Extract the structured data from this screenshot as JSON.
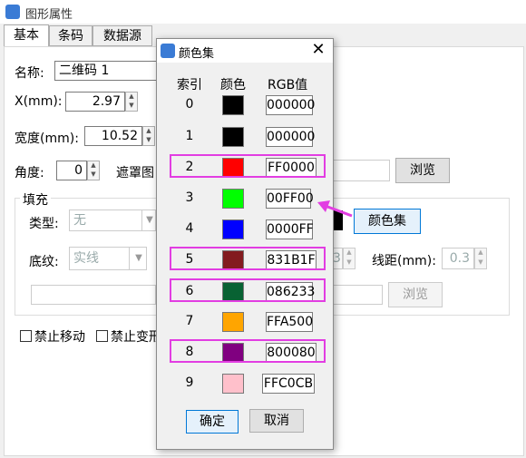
{
  "window": {
    "title": "图形属性"
  },
  "tabs": [
    "基本",
    "条码",
    "数据源"
  ],
  "form": {
    "name_label": "名称:",
    "name_value": "二维码 1",
    "x_label": "X(mm):",
    "x_value": "2.97",
    "width_label": "宽度(mm):",
    "width_value": "10.52",
    "angle_label": "角度:",
    "angle_value": "0",
    "mask_label": "遮罩图",
    "browse_label": "浏览",
    "fill_group": "填充",
    "type_label": "类型:",
    "type_value": "无",
    "pattern_label": "底纹:",
    "pattern_value": "实线",
    "color_set_label": "颜色集",
    "line_spacing_label": "线距(mm):",
    "line_spacing_value": "0.3",
    "partial_spin_value": "3",
    "browse2_label": "浏览",
    "lock_move_label": "禁止移动",
    "lock_transform_label": "禁止变形"
  },
  "dialog": {
    "title": "颜色集",
    "close_icon": "close-icon",
    "col_index": "索引",
    "col_color": "颜色",
    "col_rgb": "RGB值",
    "ok_label": "确定",
    "cancel_label": "取消",
    "rows": [
      {
        "index": "0",
        "rgb": "000000",
        "color": "#000000",
        "highlight": false
      },
      {
        "index": "1",
        "rgb": "000000",
        "color": "#000000",
        "highlight": false
      },
      {
        "index": "2",
        "rgb": "FF0000",
        "color": "#FF0000",
        "highlight": true
      },
      {
        "index": "3",
        "rgb": "00FF00",
        "color": "#00FF00",
        "highlight": false
      },
      {
        "index": "4",
        "rgb": "0000FF",
        "color": "#0000FF",
        "highlight": false
      },
      {
        "index": "5",
        "rgb": "831B1F",
        "color": "#831B1F",
        "highlight": true
      },
      {
        "index": "6",
        "rgb": "086233",
        "color": "#086233",
        "highlight": true
      },
      {
        "index": "7",
        "rgb": "FFA500",
        "color": "#FFA500",
        "highlight": false
      },
      {
        "index": "8",
        "rgb": "800080",
        "color": "#800080",
        "highlight": true
      },
      {
        "index": "9",
        "rgb": "FFC0CB",
        "color": "#FFC0CB",
        "highlight": false
      }
    ]
  },
  "annotation": {
    "arrow_color": "#e23de2"
  }
}
